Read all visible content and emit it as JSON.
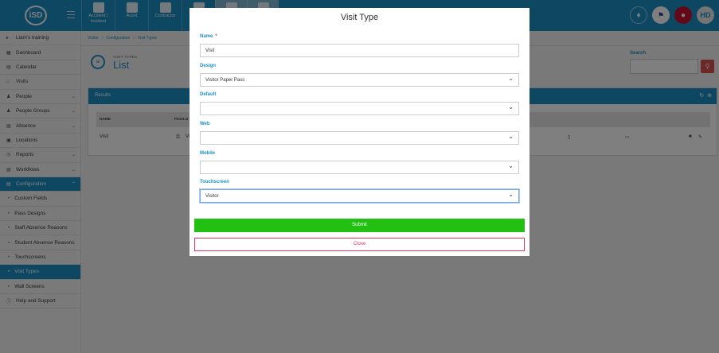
{
  "topbar": {
    "logo": "iSD",
    "modules": [
      {
        "label": "Accident / Incident"
      },
      {
        "label": "Asset"
      },
      {
        "label": "Contractor"
      }
    ],
    "user_initials": "HD"
  },
  "sidebar": {
    "items": [
      {
        "label": "Liam's training",
        "icon": "training-icon"
      },
      {
        "label": "Dashboard",
        "icon": "dashboard-icon"
      },
      {
        "label": "Calendar",
        "icon": "calendar-icon"
      },
      {
        "label": "Visits",
        "icon": "visits-icon"
      },
      {
        "label": "People",
        "icon": "people-icon"
      },
      {
        "label": "People Groups",
        "icon": "groups-icon"
      },
      {
        "label": "Absence",
        "icon": "absence-icon"
      },
      {
        "label": "Locations",
        "icon": "locations-icon"
      },
      {
        "label": "Reports",
        "icon": "reports-icon"
      },
      {
        "label": "Workflows",
        "icon": "workflows-icon"
      },
      {
        "label": "Configuration",
        "icon": "configuration-icon"
      },
      {
        "label": "Custom Fields"
      },
      {
        "label": "Pass Designs"
      },
      {
        "label": "Staff Absence Reasons"
      },
      {
        "label": "Student Absence Reasons"
      },
      {
        "label": "Touchscreens"
      },
      {
        "label": "Visit Types"
      },
      {
        "label": "Wall Screens"
      },
      {
        "label": "Help and Support",
        "icon": "help-icon"
      }
    ]
  },
  "breadcrumb": [
    "Visitor",
    "Configuration",
    "Visit Types"
  ],
  "page": {
    "kicker": "VISIT TYPES",
    "title": "List",
    "search_label": "Search"
  },
  "results": {
    "title": "Results",
    "columns": [
      "NAME",
      "PASS D"
    ],
    "rows": [
      {
        "name": "Visit",
        "pass": "Vi"
      }
    ]
  },
  "modal": {
    "title": "Visit Type",
    "name_label": "Name",
    "name_required": "*",
    "name_value": "Visit",
    "design_label": "Design",
    "design_value": "Visitor Paper Pass",
    "default_label": "Default",
    "default_value": "",
    "web_label": "Web",
    "web_value": "",
    "mobile_label": "Mobile",
    "mobile_value": "",
    "touchscreen_label": "Touchscreen",
    "touchscreen_value": "Visitor",
    "submit_label": "Submit",
    "close_label": "Close"
  },
  "colors": {
    "brand": "#1c8fc4",
    "submit": "#22c013",
    "close": "#e0335a"
  }
}
